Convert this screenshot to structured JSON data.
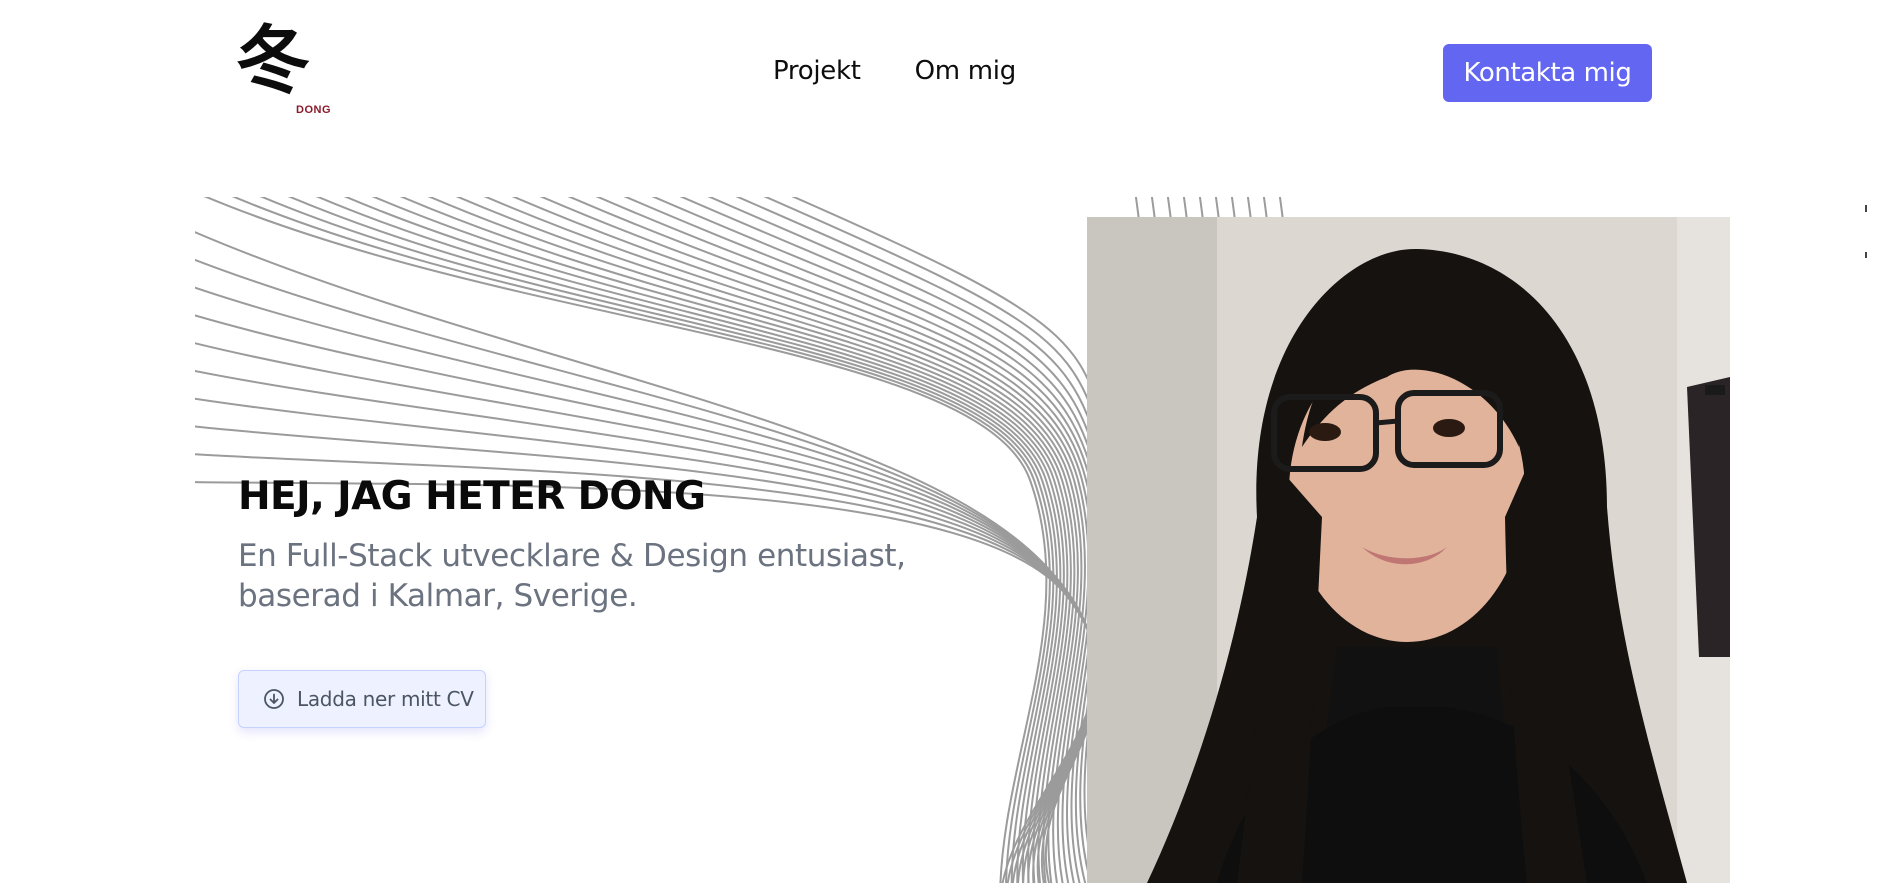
{
  "header": {
    "logo": {
      "glyph": "冬",
      "wordmark": "DONG"
    },
    "nav": [
      {
        "label": "Projekt"
      },
      {
        "label": "Om mig"
      }
    ],
    "contact_button": "Kontakta mig"
  },
  "hero": {
    "title": "HEJ, JAG HETER DONG",
    "subtitle_line1": "En Full-Stack utvecklare & Design entusiast,",
    "subtitle_line2": "baserad i Kalmar, Sverige.",
    "cv_button": "Ladda ner mitt CV",
    "cv_icon": "download-circle-icon",
    "photo": "portrait-photo"
  },
  "colors": {
    "accent": "#6366f1",
    "text_dark": "#0a0a0a",
    "text_muted": "#6b7280",
    "logo_red": "#8b1a2b",
    "cv_bg": "#eef1ff"
  }
}
